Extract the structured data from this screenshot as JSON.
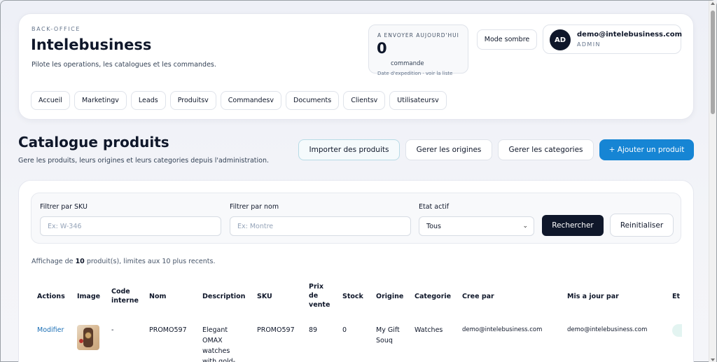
{
  "header": {
    "eyebrow": "BACK-OFFICE",
    "title": "Intelebusiness",
    "subtitle": "Pilote les operations, les catalogues et les commandes.",
    "shipping": {
      "label": "A ENVOYER AUJOURD'HUI",
      "count": "0",
      "unit": "commande",
      "link": "Date d'expedition · voir la liste"
    },
    "dark_mode_label": "Mode sombre",
    "user": {
      "initials": "AD",
      "email": "demo@intelebusiness.com",
      "role": "ADMIN"
    },
    "nav": [
      {
        "label": "Accueil"
      },
      {
        "label": "Marketingv"
      },
      {
        "label": "Leads"
      },
      {
        "label": "Produitsv"
      },
      {
        "label": "Commandesv"
      },
      {
        "label": "Documents"
      },
      {
        "label": "Clientsv"
      },
      {
        "label": "Utilisateursv"
      }
    ]
  },
  "page": {
    "title": "Catalogue produits",
    "subtitle": "Gere les produits, leurs origines et leurs categories depuis l'administration.",
    "actions": {
      "import": "Importer des produits",
      "origins": "Gerer les origines",
      "categories": "Gerer les categories",
      "add": "+ Ajouter un produit"
    }
  },
  "filters": {
    "sku_label": "Filtrer par SKU",
    "sku_placeholder": "Ex: W-346",
    "name_label": "Filtrer par nom",
    "name_placeholder": "Ex: Montre",
    "state_label": "Etat actif",
    "state_value": "Tous",
    "search_label": "Rechercher",
    "reset_label": "Reinitialiser"
  },
  "summary": {
    "prefix": "Affichage de",
    "count": "10",
    "suffix": "produit(s), limites aux 10 plus recents."
  },
  "table": {
    "headers": {
      "actions": "Actions",
      "image": "Image",
      "code_1": "Code",
      "code_2": "interne",
      "name": "Nom",
      "description": "Description",
      "sku": "SKU",
      "price_1": "Prix",
      "price_2": "de",
      "price_3": "vente",
      "stock": "Stock",
      "origin": "Origine",
      "category": "Categorie",
      "created_by": "Cree par",
      "updated_by": "Mis a jour par",
      "state": "Et"
    },
    "rows": [
      {
        "action": "Modifier",
        "code": "-",
        "name": "PROMO597",
        "desc_1": "Elegant",
        "desc_2": "OMAX",
        "desc_3": "watches",
        "desc_4": "with gold-",
        "sku": "PROMO597",
        "price": "89",
        "stock": "0",
        "origin_1": "My Gift",
        "origin_2": "Souq",
        "category": "Watches",
        "created_by": "demo@intelebusiness.com",
        "updated_by": "demo@intelebusiness.com"
      }
    ]
  }
}
